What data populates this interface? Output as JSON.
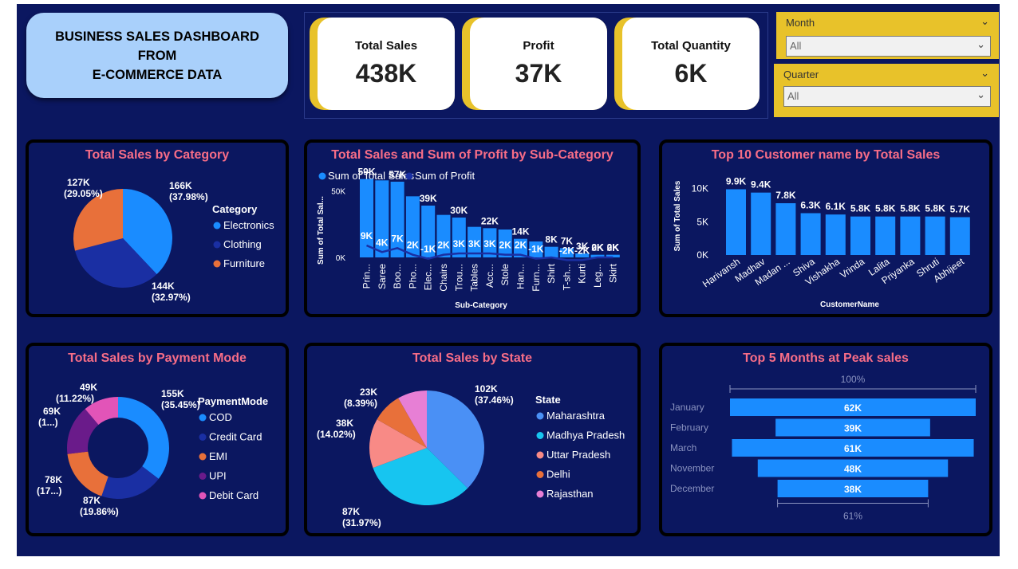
{
  "header": {
    "title_line1": "BUSINESS SALES DASHBOARD",
    "title_line2": "FROM",
    "title_line3": "E-COMMERCE DATA"
  },
  "kpis": [
    {
      "label": "Total Sales",
      "value": "438K"
    },
    {
      "label": "Profit",
      "value": "37K"
    },
    {
      "label": "Total Quantity",
      "value": "6K"
    }
  ],
  "slicers": [
    {
      "label": "Month",
      "value": "All"
    },
    {
      "label": "Quarter",
      "value": "All"
    }
  ],
  "colors": {
    "background": "#0b1760",
    "title_box": "#a9d0fb",
    "accent_yellow": "#e8c22a",
    "chart_title": "#f76d87",
    "bar_blue": "#1a8cff",
    "dark_blue": "#1a2fa3",
    "orange": "#e8703a",
    "purple": "#6a1b8a",
    "pink": "#e254b8",
    "cyan": "#17c5f0",
    "salmon": "#f88a86"
  },
  "chart_data": [
    {
      "type": "pie",
      "title": "Total Sales by Category",
      "legend_title": "Category",
      "legend_position": "right",
      "categories": [
        "Electronics",
        "Clothing",
        "Furniture"
      ],
      "values": [
        166,
        144,
        127
      ],
      "labels": [
        "166K",
        "144K",
        "127K"
      ],
      "percents": [
        "(37.98%)",
        "(32.97%)",
        "(29.05%)"
      ],
      "colors": [
        "#1a8cff",
        "#1a2fa3",
        "#e8703a"
      ]
    },
    {
      "type": "bar",
      "title": "Total Sales and Sum of Profit by Sub-Category",
      "xlabel": "Sub-Category",
      "ylabel": "Sum of Total Sal...",
      "ylim": [
        0,
        60
      ],
      "yticks": [
        "0K",
        "50K"
      ],
      "legend_position": "top-left",
      "categories": [
        "Prin...",
        "Saree",
        "Boo...",
        "Pho...",
        "Elec...",
        "Chairs",
        "Trou...",
        "Tables",
        "Acc...",
        "Stole",
        "Han...",
        "Furn...",
        "Shirt",
        "T-sh...",
        "Kurti",
        "Leg...",
        "Skirt"
      ],
      "series": [
        {
          "name": "Sum of Total Sales",
          "values": [
            59,
            58,
            57,
            46,
            39,
            32,
            30,
            23,
            22,
            21,
            14,
            12,
            8,
            7,
            3,
            2,
            2
          ],
          "labels": [
            "59K",
            "",
            "57K",
            "",
            "39K",
            "",
            "30K",
            "",
            "22K",
            "",
            "14K",
            "",
            "8K",
            "7K",
            "3K",
            "2K",
            "2K"
          ]
        },
        {
          "name": "Sum of Profit",
          "values": [
            9,
            4,
            7,
            2,
            -1,
            2,
            3,
            3,
            3,
            2,
            2,
            -1,
            0,
            -2,
            -2,
            0,
            0
          ],
          "labels": [
            "9K",
            "4K",
            "7K",
            "2K",
            "-1K",
            "2K",
            "3K",
            "3K",
            "3K",
            "2K",
            "2K",
            "-1K",
            "",
            "-2K",
            "-2K",
            "0K",
            "0K"
          ]
        }
      ]
    },
    {
      "type": "bar",
      "title": "Top 10 Customer name by Total Sales",
      "xlabel": "CustomerName",
      "ylabel": "Sum of Total Sales",
      "ylim": [
        0,
        10.8
      ],
      "yticks": [
        "0K",
        "5K",
        "10K"
      ],
      "categories": [
        "Harivansh",
        "Madhav",
        "Madan ...",
        "Shiva",
        "Vishakha",
        "Vrinda",
        "Lalita",
        "Priyanka",
        "Shruti",
        "Abhijeet"
      ],
      "values": [
        9.9,
        9.4,
        7.8,
        6.3,
        6.1,
        5.8,
        5.8,
        5.8,
        5.8,
        5.7
      ],
      "labels": [
        "9.9K",
        "9.4K",
        "7.8K",
        "6.3K",
        "6.1K",
        "5.8K",
        "5.8K",
        "5.8K",
        "5.8K",
        "5.7K"
      ]
    },
    {
      "type": "pie",
      "title": "Total Sales by Payment Mode",
      "legend_title": "PaymentMode",
      "legend_position": "right",
      "donut": true,
      "categories": [
        "COD",
        "Credit Card",
        "EMI",
        "UPI",
        "Debit Card"
      ],
      "values": [
        155,
        87,
        78,
        69,
        49
      ],
      "labels": [
        "155K",
        "87K",
        "78K",
        "69K",
        "49K"
      ],
      "percents": [
        "(35.45%)",
        "(19.86%)",
        "(17...)",
        "(1...)",
        "(11.22%)"
      ],
      "colors": [
        "#1a8cff",
        "#1a2fa3",
        "#e8703a",
        "#6a1b8a",
        "#e254b8"
      ]
    },
    {
      "type": "pie",
      "title": "Total Sales by State",
      "legend_title": "State",
      "legend_position": "right",
      "categories": [
        "Maharashtra",
        "Madhya Pradesh",
        "Uttar Pradesh",
        "Delhi",
        "Rajasthan"
      ],
      "values": [
        102,
        87,
        38,
        23,
        22.6
      ],
      "labels": [
        "102K",
        "87K",
        "38K",
        "23K",
        ""
      ],
      "percents": [
        "(37.46%)",
        "(31.97%)",
        "(14.02%)",
        "(8.39%)",
        ""
      ],
      "colors": [
        "#4a90f5",
        "#17c5f0",
        "#f88a86",
        "#e8703a",
        "#e77fd5"
      ]
    },
    {
      "type": "bar",
      "title": "Top 5 Months at Peak sales",
      "subtype": "funnel",
      "categories": [
        "January",
        "February",
        "March",
        "November",
        "December"
      ],
      "values": [
        62,
        39,
        61,
        48,
        38
      ],
      "labels": [
        "62K",
        "39K",
        "61K",
        "48K",
        "38K"
      ],
      "top_percent": "100%",
      "bottom_percent": "61%"
    }
  ]
}
